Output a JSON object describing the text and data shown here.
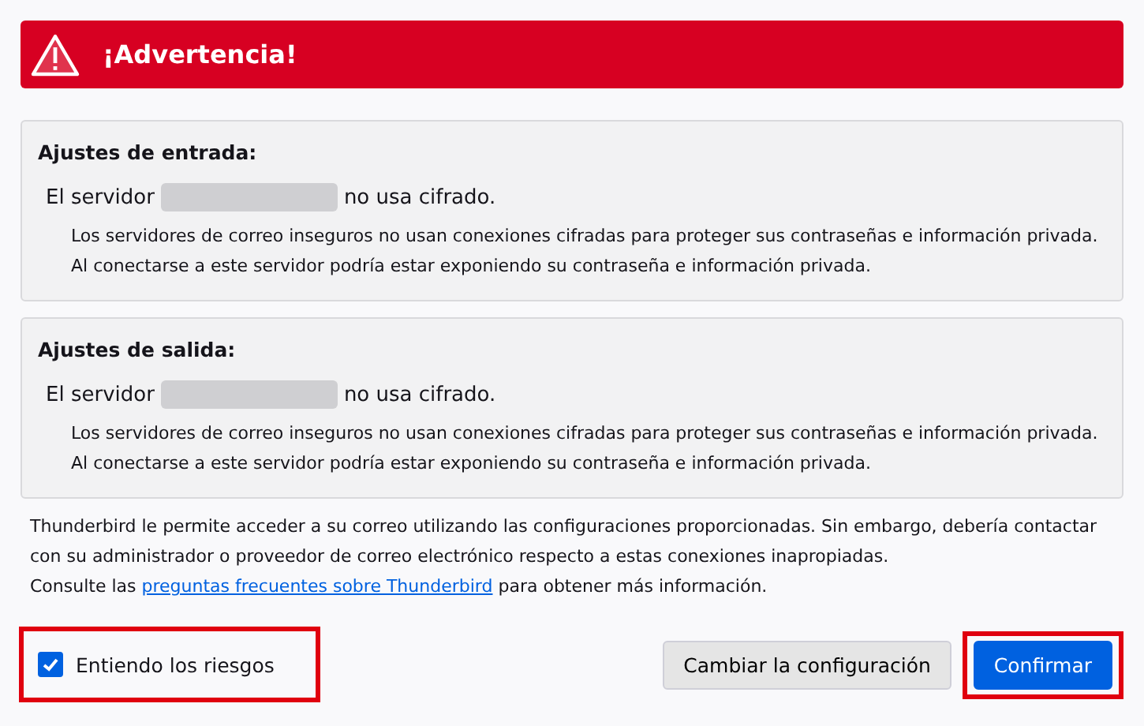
{
  "banner": {
    "title": "¡Advertencia!"
  },
  "sections": [
    {
      "heading": "Ajustes de entrada:",
      "server_prefix": "El servidor",
      "server_redacted": true,
      "server_suffix": "no usa cifrado.",
      "description": "Los servidores de correo inseguros no usan conexiones cifradas para proteger sus contraseñas e información privada. Al conectarse a este servidor podría estar exponiendo su contraseña e información privada."
    },
    {
      "heading": "Ajustes de salida:",
      "server_prefix": "El servidor",
      "server_redacted": true,
      "server_suffix": "no usa cifrado.",
      "description": "Los servidores de correo inseguros no usan conexiones cifradas para proteger sus contraseñas e información privada. Al conectarse a este servidor podría estar exponiendo su contraseña e información privada."
    }
  ],
  "notice": {
    "text": "Thunderbird le permite acceder a su correo utilizando las configuraciones proporcionadas. Sin embargo, debería contactar con su administrador o proveedor de correo electrónico respecto a estas conexiones inapropiadas.",
    "prefix": "Consulte las",
    "link": "preguntas frecuentes sobre Thunderbird",
    "suffix": "para obtener más información."
  },
  "checkbox": {
    "label": "Entiendo los riesgos",
    "checked": true,
    "highlighted": true
  },
  "buttons": [
    {
      "label": "Cambiar la configuración",
      "kind": "secondary",
      "highlighted": false
    },
    {
      "label": "Confirmar",
      "kind": "primary",
      "highlighted": true
    }
  ]
}
